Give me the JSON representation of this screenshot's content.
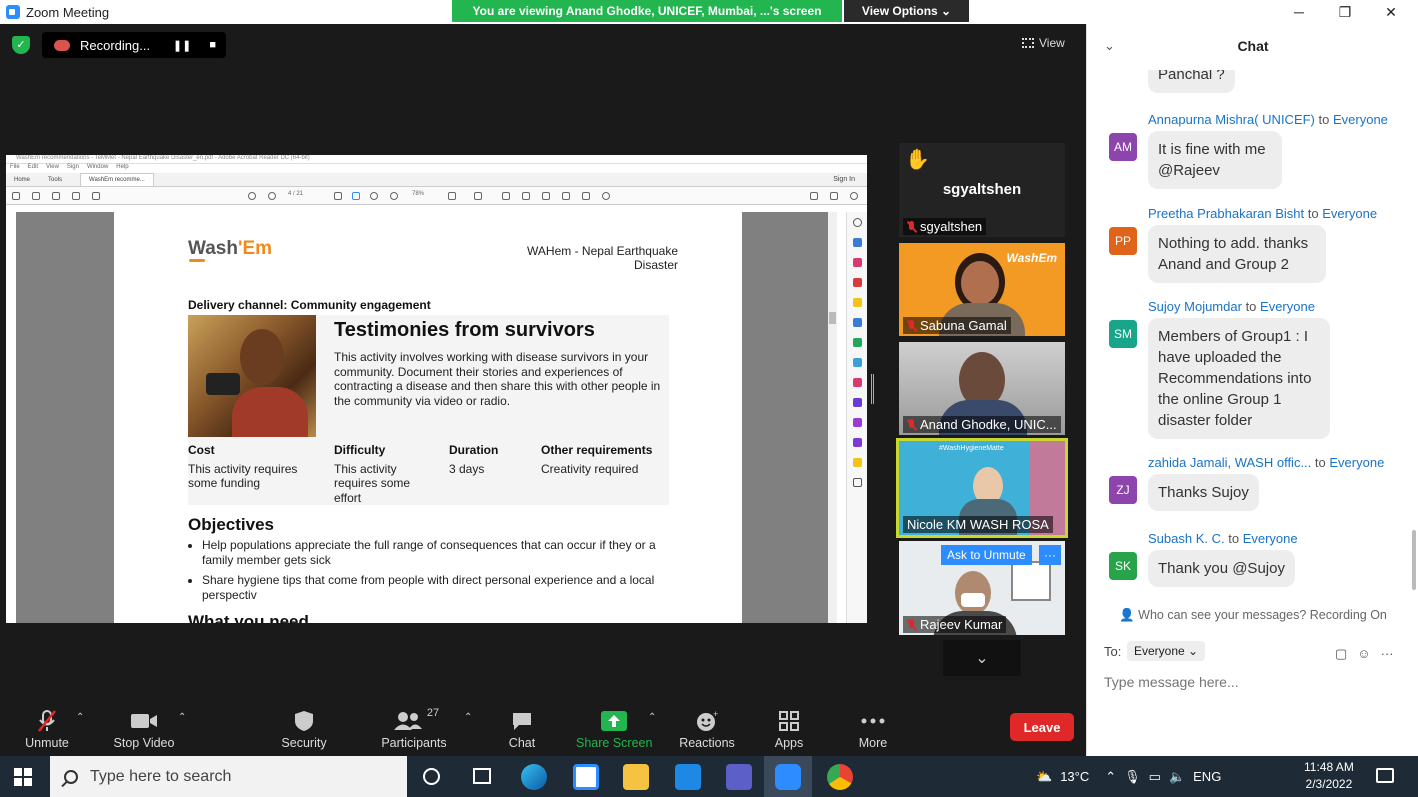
{
  "window": {
    "title": "Zoom Meeting",
    "viewing_banner": "You are viewing Anand Ghodke, UNICEF, Mumbai, ...'s screen",
    "view_options": "View Options ⌄",
    "min": "─",
    "max": "❐",
    "close": "✕"
  },
  "recording": {
    "label": "Recording...",
    "pause": "❚❚",
    "stop": "■"
  },
  "view_button": "View",
  "shared_doc": {
    "acro_title": "WashEm recommendations - TeMMet - Nepal Earthquake Disaster_en.pdf - Adobe Acrobat Reader DC (64-bit)",
    "menu": [
      "File",
      "Edit",
      "View",
      "Sign",
      "Window",
      "Help"
    ],
    "tabs": [
      "Home",
      "Tools",
      "WashEm recomme..."
    ],
    "signin": "Sign In",
    "page_field": "4 / 21",
    "zoom": "78%",
    "logo_a": "Wash",
    "logo_b": "'Em",
    "title": "WAHem - Nepal Earthquake Disaster",
    "channel": "Delivery channel: Community engagement",
    "card_title": "Testimonies from survivors",
    "card_desc": "This activity involves working with disease survivors in your community. Document their stories and experiences of contracting a disease and then share this with other people in the community via video or radio.",
    "cols": [
      {
        "h": "Cost",
        "v": "This activity requires some funding"
      },
      {
        "h": "Difficulty",
        "v": "This activity requires some effort"
      },
      {
        "h": "Duration",
        "v": "3 days"
      },
      {
        "h": "Other requirements",
        "v": "Creativity required"
      }
    ],
    "objectives_h": "Objectives",
    "objectives": [
      "Help populations appreciate the full range of consequences that can occur if they or a family member gets sick",
      "Share hygiene tips that come from people with direct personal experience and a local perspectiv"
    ],
    "cutoff_heading": "What you need"
  },
  "participants_tiles": [
    {
      "name": "sgyaltshen",
      "big_name": "sgyaltshen",
      "hand": "✋"
    },
    {
      "name": "Sabuna Gamal",
      "overlay": "WashEm"
    },
    {
      "name": "Anand Ghodke, UNIC..."
    },
    {
      "name": "Nicole KM WASH ROSA",
      "banner": "#WashHygieneMatte"
    },
    {
      "name": "Rajeev Kumar",
      "ask_unmute": "Ask to Unmute",
      "more": "···"
    }
  ],
  "tile_scroll": "⌄",
  "toolbar": {
    "unmute": "Unmute",
    "stop_video": "Stop Video",
    "security": "Security",
    "participants": "Participants",
    "participants_count": "27",
    "chat": "Chat",
    "share_screen": "Share Screen",
    "reactions": "Reactions",
    "apps": "Apps",
    "more": "More",
    "leave": "Leave"
  },
  "chat": {
    "title": "Chat",
    "collapse": "⌄",
    "partial": "Panchal ?",
    "messages": [
      {
        "initials": "AM",
        "color": "#8e44ad",
        "sender": "Annapurna Mishra( UNICEF)",
        "to": "Everyone",
        "text": "It is fine with me @Rajeev"
      },
      {
        "initials": "PP",
        "color": "#e0631c",
        "sender": "Preetha Prabhakaran Bisht",
        "to": "Everyone",
        "text": "Nothing to add. thanks Anand and Group 2"
      },
      {
        "initials": "SM",
        "color": "#19a589",
        "sender": "Sujoy Mojumdar",
        "to": "Everyone",
        "text": "Members of Group1 : I have uploaded the Recommendations into the online Group 1 disaster folder"
      },
      {
        "initials": "ZJ",
        "color": "#8e44ad",
        "sender": "zahida Jamali, WASH offic...",
        "to": "Everyone",
        "text": "Thanks Sujoy"
      },
      {
        "initials": "SK",
        "color": "#27a34a",
        "sender": "Subash K. C.",
        "to": "Everyone",
        "text": "Thank you @Sujoy"
      }
    ],
    "to_word": "to",
    "who_can_see": "Who can see your messages? Recording On",
    "to_label": "To:",
    "to_value": "Everyone ⌄",
    "placeholder": "Type message here..."
  },
  "taskbar": {
    "search_placeholder": "Type here to search",
    "weather": "13°C",
    "lang": "ENG",
    "time": "11:48 AM",
    "date": "2/3/2022"
  },
  "colors": {
    "zoom_blue": "#2d8cff",
    "green": "#23b550",
    "leave_red": "#e02828"
  }
}
